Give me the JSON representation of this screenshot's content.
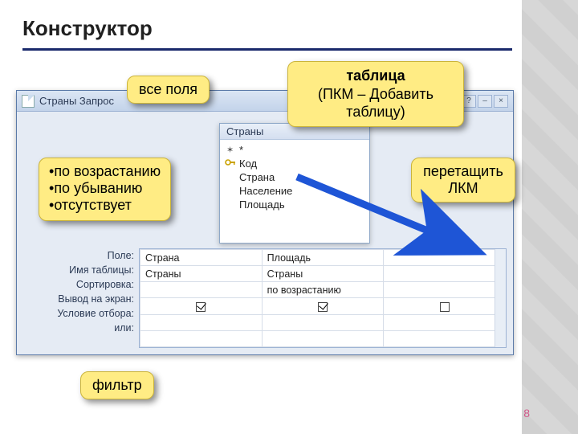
{
  "page": {
    "title": "Конструктор",
    "number": "8"
  },
  "callouts": {
    "all_fields": "все поля",
    "table_title": "таблица",
    "table_sub": "(ПКМ – Добавить таблицу)",
    "drag": "перетащить ЛКМ",
    "filter": "фильтр"
  },
  "sort_options": [
    "по возрастанию",
    "по убыванию",
    "отсутствует"
  ],
  "window": {
    "title": "Страны Запрос",
    "fieldlist_title": "Страны",
    "fields": [
      "*",
      "Код",
      "Страна",
      "Население",
      "Площадь"
    ]
  },
  "grid": {
    "labels": [
      "Поле:",
      "Имя таблицы:",
      "Сортировка:",
      "Вывод на экран:",
      "Условие отбора:",
      "или:"
    ],
    "columns": [
      {
        "field": "Страна",
        "table": "Страны",
        "sort": "",
        "show": true
      },
      {
        "field": "Площадь",
        "table": "Страны",
        "sort": "по возрастанию",
        "show": true
      },
      {
        "field": "",
        "table": "",
        "sort": "",
        "show": false
      }
    ]
  }
}
